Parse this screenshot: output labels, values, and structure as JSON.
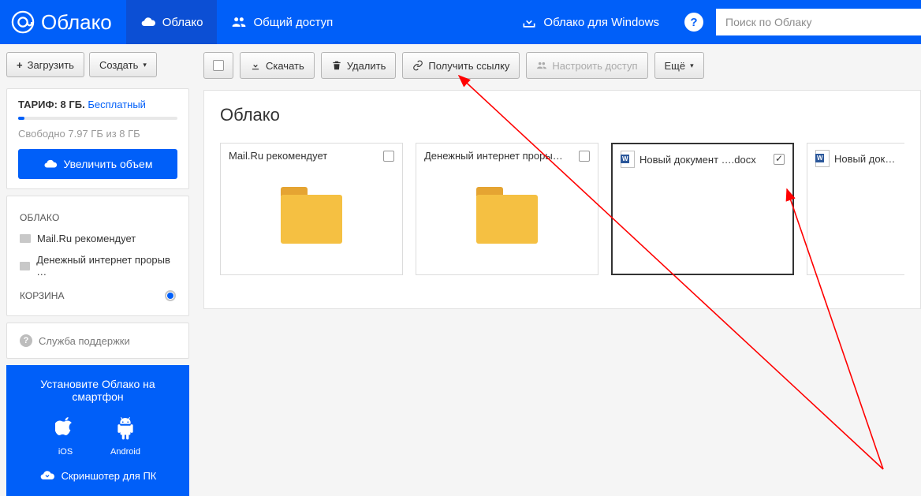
{
  "header": {
    "logo_text": "Облако",
    "tab_cloud": "Облако",
    "tab_shared": "Общий доступ",
    "windows_promo": "Облако для Windows",
    "help": "?",
    "search_placeholder": "Поиск по Облаку"
  },
  "sidebar": {
    "upload_btn": "Загрузить",
    "create_btn": "Создать",
    "tariff_label": "ТАРИФ: 8 ГБ.",
    "tariff_plan": "Бесплатный",
    "free_space": "Свободно 7.97 ГБ из 8 ГБ",
    "increase_btn": "Увеличить объем",
    "heading_cloud": "ОБЛАКО",
    "folders": [
      "Mail.Ru рекомендует",
      "Денежный интернет прорыв …"
    ],
    "heading_trash": "КОРЗИНА",
    "support": "Служба поддержки",
    "promo_title": "Установите Облако на смартфон",
    "promo_ios": "iOS",
    "promo_android": "Android",
    "promo_screenshot": "Скриншотер для ПК"
  },
  "toolbar": {
    "download": "Скачать",
    "delete": "Удалить",
    "get_link": "Получить ссылку",
    "access": "Настроить доступ",
    "more": "Ещё"
  },
  "content": {
    "title": "Облако",
    "tiles": [
      {
        "label": "Mail.Ru рекомендует",
        "type": "folder",
        "checked": false
      },
      {
        "label": "Денежный интернет проры…",
        "type": "folder",
        "checked": false
      },
      {
        "label": "Новый документ ….docx",
        "type": "doc",
        "checked": true
      },
      {
        "label": "Новый докумен",
        "type": "doc",
        "checked": false
      }
    ]
  }
}
